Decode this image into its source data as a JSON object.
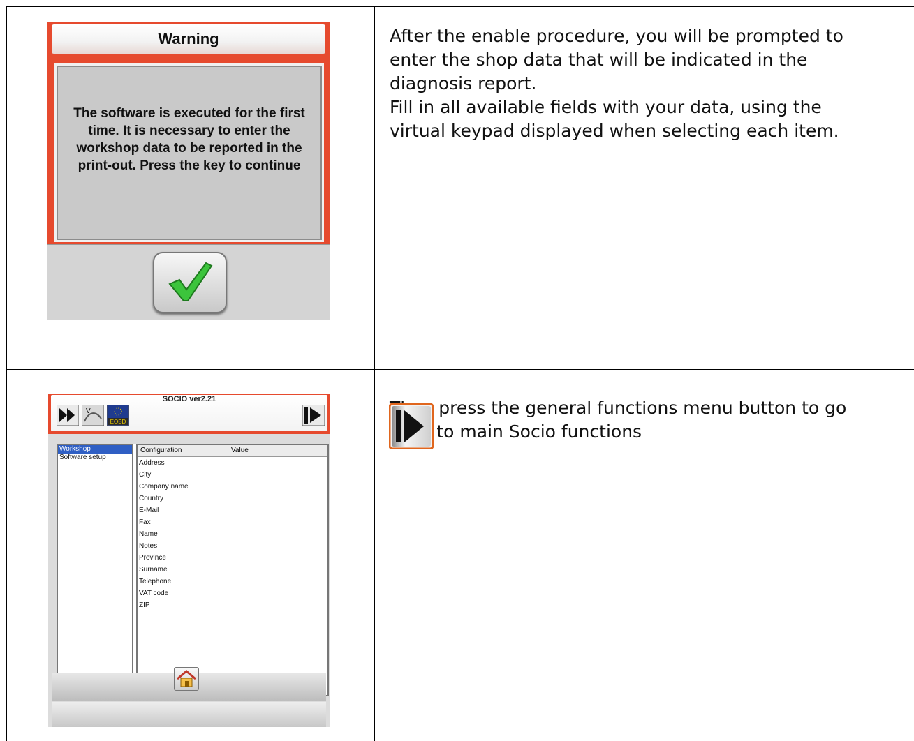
{
  "warning_dialog": {
    "title": "Warning",
    "message": "The software is executed for the first time. It is necessary to enter the workshop data to be reported in the print-out. Press the key to continue",
    "ok_icon": "check-icon"
  },
  "text1": {
    "lines": [
      "After the enable procedure, you will be prompted to",
      "enter the shop data that will be indicated in the",
      "diagnosis report.",
      "Fill in all available fields with your data, using the",
      "virtual keypad displayed when selecting each item."
    ]
  },
  "socio_screen": {
    "title": "SOCIO ver2.21",
    "toolbar_icons": [
      "forward-icon",
      "vehicle-icon",
      "eobd-icon",
      "exit-icon"
    ],
    "eobd_label": "EOBD",
    "left_items": [
      "Workshop",
      "Software setup"
    ],
    "selected_item": "Workshop",
    "columns": [
      "Configuration",
      "Value"
    ],
    "rows": [
      "Address",
      "City",
      "Company name",
      "Country",
      "E-Mail",
      "Fax",
      "Name",
      "Notes",
      "Province",
      "Surname",
      "Telephone",
      "VAT code",
      "ZIP"
    ],
    "home_icon": "home-icon"
  },
  "text2": {
    "lines": [
      "Then press the general functions menu button to go",
      "back to main Socio functions"
    ],
    "icon": "general-functions-exit-icon"
  }
}
